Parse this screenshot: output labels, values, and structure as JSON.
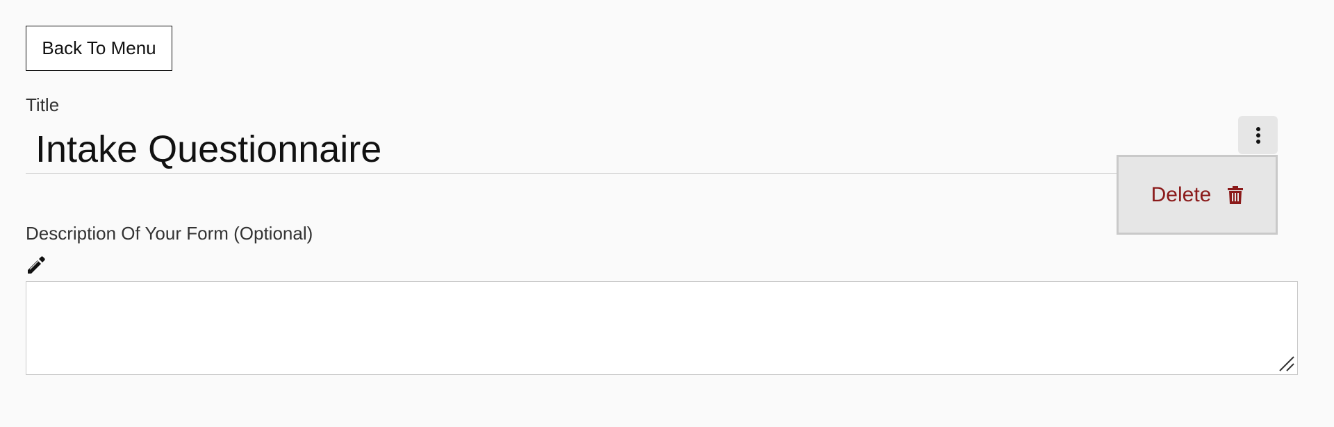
{
  "toolbar": {
    "back_label": "Back To Menu"
  },
  "title_field": {
    "label": "Title",
    "value": "Intake Questionnaire"
  },
  "menu": {
    "kebab_icon": "more-vertical-icon",
    "items": [
      {
        "label": "Delete",
        "icon": "trash-icon",
        "color": "#8b1a1a"
      }
    ]
  },
  "description_field": {
    "label": "Description Of Your Form (Optional)",
    "edit_icon": "pencil-icon",
    "value": ""
  }
}
